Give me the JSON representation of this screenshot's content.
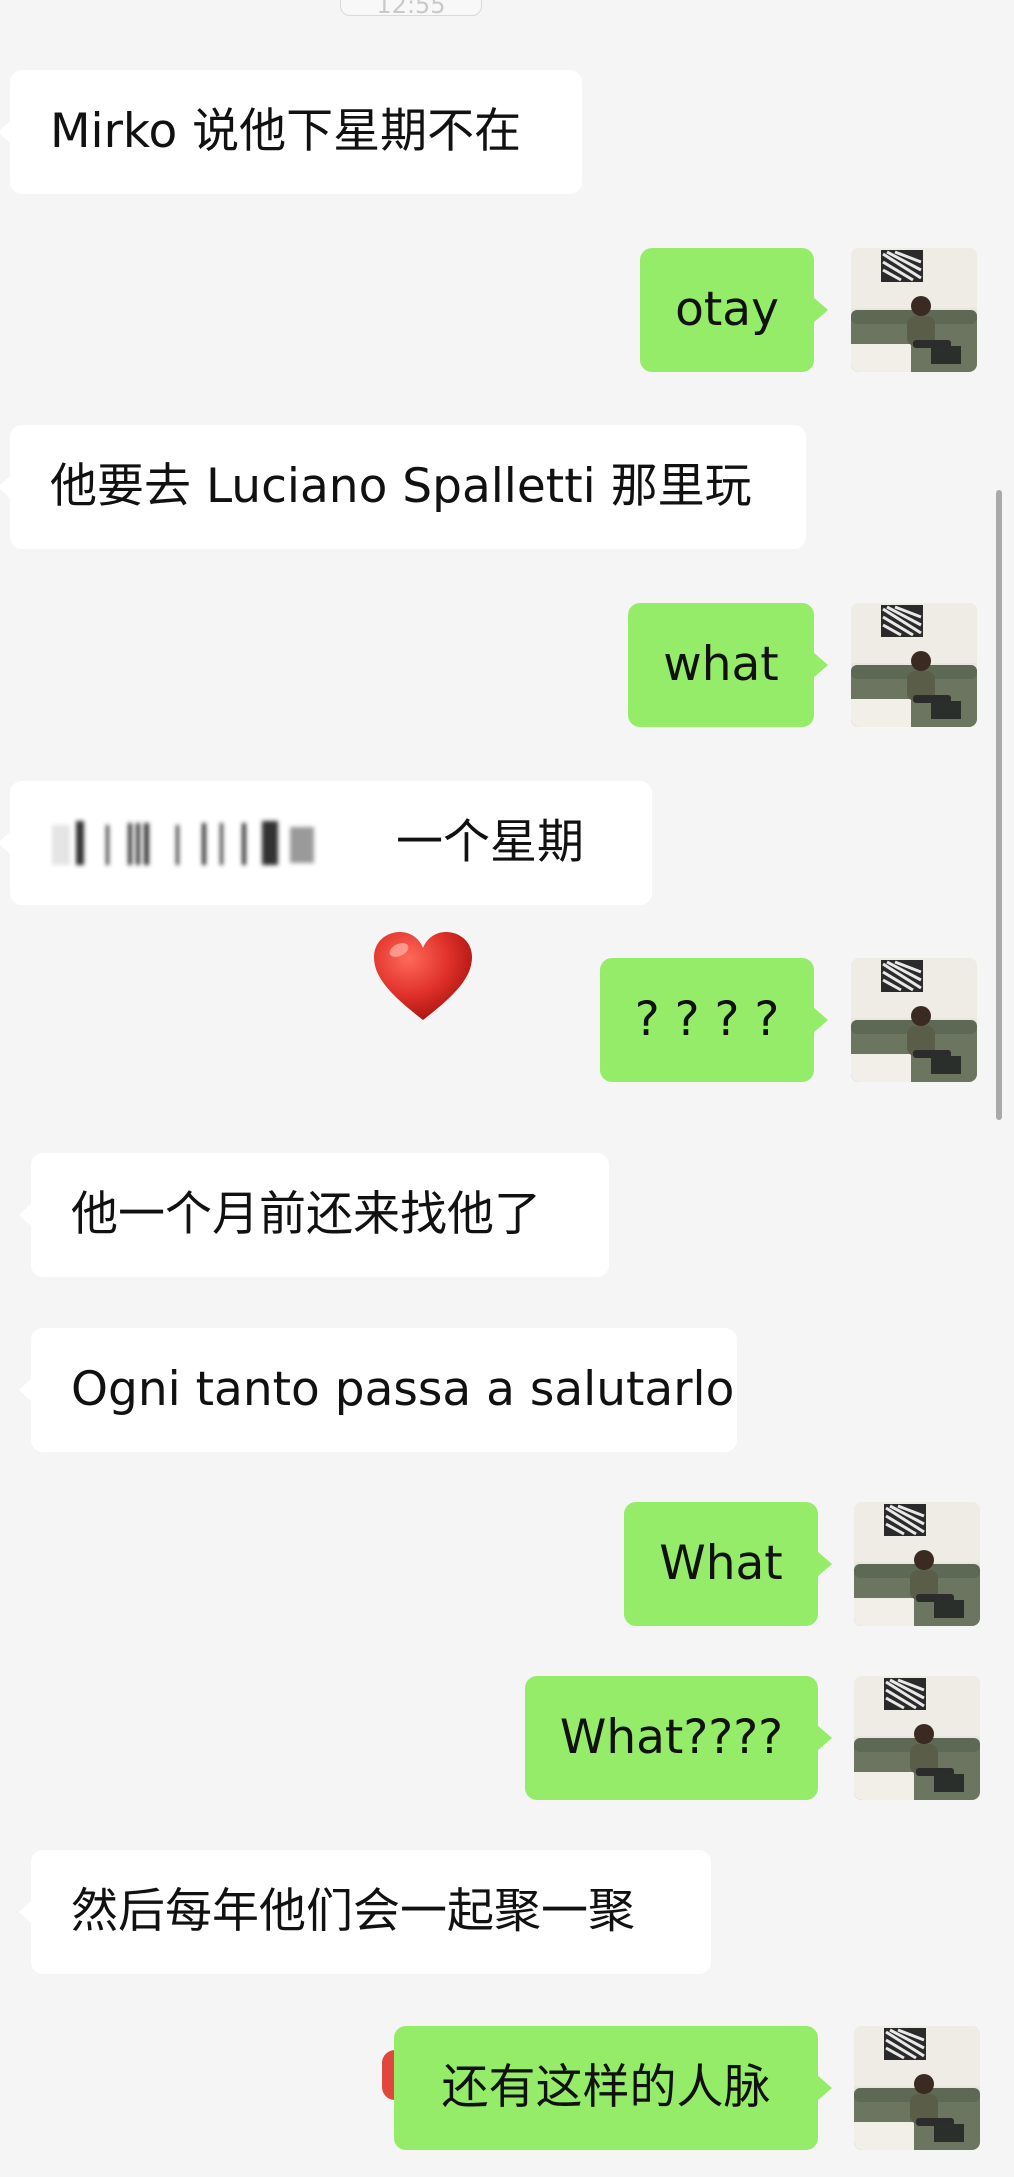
{
  "timestamp": "12:55",
  "colors": {
    "background": "#f5f5f5",
    "outgoing_bubble": "#95ec69",
    "incoming_bubble": "#ffffff",
    "heart": "#e0312a"
  },
  "messages": [
    {
      "direction": "incoming",
      "text": "Mirko 说他下星期不在"
    },
    {
      "direction": "outgoing",
      "text": "otay"
    },
    {
      "direction": "incoming",
      "text": "他要去 Luciano Spalletti 那里玩"
    },
    {
      "direction": "outgoing",
      "text": "what"
    },
    {
      "direction": "incoming",
      "text": "一个星期",
      "note_icon": "blurred-text"
    },
    {
      "direction": "outgoing",
      "text": "? ? ? ?"
    },
    {
      "direction": "incoming",
      "text": "他一个月前还来找他了"
    },
    {
      "direction": "incoming",
      "text": "Ogni tanto passa a salutarlo"
    },
    {
      "direction": "outgoing",
      "text": "What"
    },
    {
      "direction": "outgoing",
      "text": "What????"
    },
    {
      "direction": "incoming",
      "text": "然后每年他们会一起聚一聚"
    },
    {
      "direction": "outgoing",
      "text": "还有这样的人脉"
    }
  ],
  "sticker": {
    "icon": "heart-icon"
  },
  "avatar": {
    "icon": "user-avatar-photo"
  }
}
